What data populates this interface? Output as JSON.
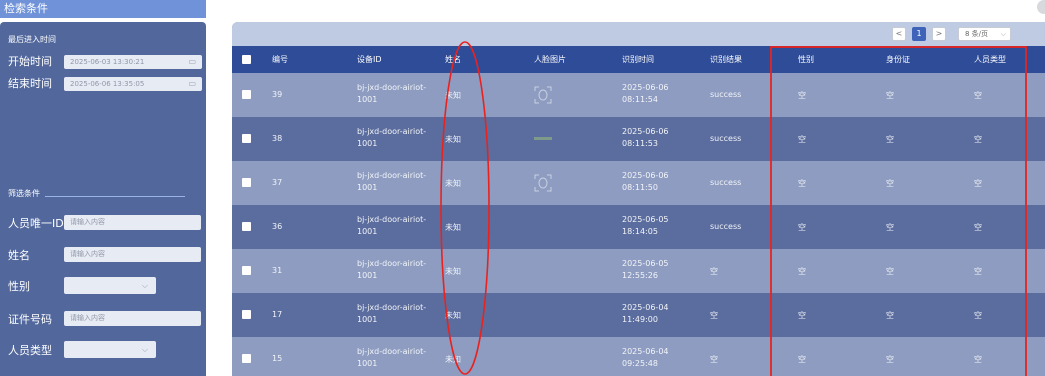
{
  "sidebar": {
    "title": "检索条件",
    "last_entry_section": "最后进入时间",
    "start_label": "开始时间",
    "start_value": "2025-06-03 13:30:21",
    "end_label": "结束时间",
    "end_value": "2025-06-06 13:35:05",
    "filter_section": "筛选条件",
    "person_id_label": "人员唯一ID",
    "person_id_placeholder": "请输入内容",
    "name_label": "姓名",
    "name_placeholder": "请输入内容",
    "gender_label": "性别",
    "id_number_label": "证件号码",
    "id_number_placeholder": "请输入内容",
    "person_type_label": "人员类型"
  },
  "pagination": {
    "prev": "<",
    "page": "1",
    "next": ">",
    "page_size": "8 条/页"
  },
  "table": {
    "headers": [
      "编号",
      "设备ID",
      "姓名",
      "人脸图片",
      "识别时间",
      "识别结果",
      "性别",
      "身份证",
      "人员类型"
    ],
    "rows": [
      {
        "id": "39",
        "device1": "bj-jxd-door-airiot-",
        "device2": "1001",
        "name": "未知",
        "face": "face-outline-icon",
        "time1": "2025-06-06",
        "time2": "08:11:54",
        "result": "success",
        "gender": "空",
        "idcard": "空",
        "ptype": "空"
      },
      {
        "id": "38",
        "device1": "bj-jxd-door-airiot-",
        "device2": "1001",
        "name": "未知",
        "face": "face-thumbnail-icon",
        "time1": "2025-06-06",
        "time2": "08:11:53",
        "result": "success",
        "gender": "空",
        "idcard": "空",
        "ptype": "空"
      },
      {
        "id": "37",
        "device1": "bj-jxd-door-airiot-",
        "device2": "1001",
        "name": "未知",
        "face": "face-outline-icon",
        "time1": "2025-06-06",
        "time2": "08:11:50",
        "result": "success",
        "gender": "空",
        "idcard": "空",
        "ptype": "空"
      },
      {
        "id": "36",
        "device1": "bj-jxd-door-airiot-",
        "device2": "1001",
        "name": "未知",
        "face": "",
        "time1": "2025-06-05",
        "time2": "18:14:05",
        "result": "success",
        "gender": "空",
        "idcard": "空",
        "ptype": "空"
      },
      {
        "id": "31",
        "device1": "bj-jxd-door-airiot-",
        "device2": "1001",
        "name": "未知",
        "face": "",
        "time1": "2025-06-05",
        "time2": "12:55:26",
        "result": "空",
        "gender": "空",
        "idcard": "空",
        "ptype": "空"
      },
      {
        "id": "17",
        "device1": "bj-jxd-door-airiot-",
        "device2": "1001",
        "name": "未知",
        "face": "",
        "time1": "2025-06-04",
        "time2": "11:49:00",
        "result": "空",
        "gender": "空",
        "idcard": "空",
        "ptype": "空"
      },
      {
        "id": "15",
        "device1": "bj-jxd-door-airiot-",
        "device2": "1001",
        "name": "未知",
        "face": "",
        "time1": "2025-06-04",
        "time2": "09:25:48",
        "result": "空",
        "gender": "空",
        "idcard": "空",
        "ptype": "空"
      }
    ]
  },
  "colors": {
    "panel": "#52689d",
    "header": "#2f4c98",
    "row_light": "#8d9cc0",
    "row_dark": "#5b6d9e",
    "annotation_red": "#e8231f"
  }
}
